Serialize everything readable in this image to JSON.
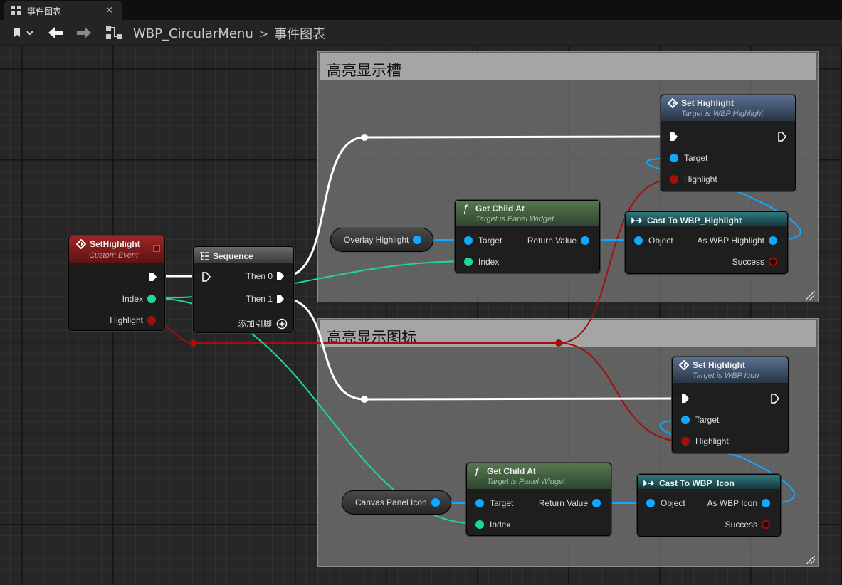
{
  "tab": {
    "label": "事件图表",
    "close": "×"
  },
  "toolbar": {
    "blueprint": "WBP_CircularMenu",
    "separator": ">",
    "graph": "事件图表"
  },
  "comments": [
    {
      "title": "高亮显示槽"
    },
    {
      "title": "高亮显示图标"
    }
  ],
  "custom_event": {
    "title": "SetHighlight",
    "subtitle": "Custom Event",
    "pins": {
      "index": "Index",
      "highlight": "Highlight"
    }
  },
  "sequence": {
    "title": "Sequence",
    "then0": "Then 0",
    "then1": "Then 1",
    "add_pin": "添加引脚"
  },
  "variables": {
    "overlay": "Overlay Highlight",
    "canvas": "Canvas Panel Icon"
  },
  "get_child_1": {
    "title": "Get Child At",
    "subtitle": "Target is Panel Widget",
    "target": "Target",
    "index": "Index",
    "return": "Return Value"
  },
  "get_child_2": {
    "title": "Get Child At",
    "subtitle": "Target is Panel Widget",
    "target": "Target",
    "index": "Index",
    "return": "Return Value"
  },
  "cast_1": {
    "title": "Cast To WBP_Highlight",
    "object": "Object",
    "as": "As WBP Highlight",
    "success": "Success"
  },
  "cast_2": {
    "title": "Cast To WBP_Icon",
    "object": "Object",
    "as": "As WBP Icon",
    "success": "Success"
  },
  "set_highlight_1": {
    "title": "Set Highlight",
    "subtitle": "Target is WBP Highlight",
    "target": "Target",
    "highlight": "Highlight"
  },
  "set_highlight_2": {
    "title": "Set Highlight",
    "subtitle": "Target is WBP Icon",
    "target": "Target",
    "highlight": "Highlight"
  },
  "colors": {
    "event_header": "#8a1d1d",
    "function_header": "#3f5a3c",
    "cast_header": "#1f5a5e",
    "call_header": "#3a4c63",
    "exec_wire": "#ffffff",
    "object_wire": "#13a7ff",
    "int_wire": "#1fd6a0",
    "bool_wire": "#a01010"
  }
}
